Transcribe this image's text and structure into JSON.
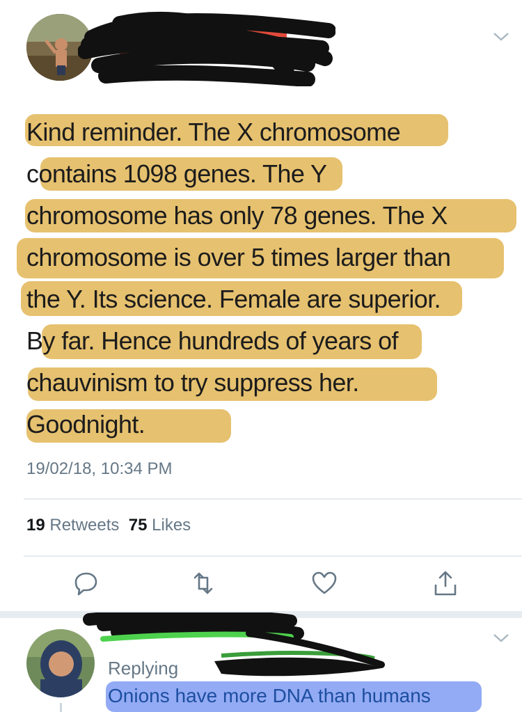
{
  "tweet": {
    "text_lines": [
      "Kind reminder. The X chromosome",
      "contains 1098 genes. The Y",
      "chromosome has only 78 genes. The X",
      "chromosome is over 5 times larger than",
      "the Y. Its science. Female are superior.",
      "By far. Hence hundreds of years of",
      "chauvinism to try suppress her.",
      "Goodnight."
    ],
    "timestamp": "19/02/18, 10:34 PM",
    "retweets_count": "19",
    "retweets_label": "Retweets",
    "likes_count": "75",
    "likes_label": "Likes"
  },
  "actions": {
    "reply_icon": "reply-icon",
    "retweet_icon": "retweet-icon",
    "like_icon": "heart-icon",
    "share_icon": "share-icon"
  },
  "reply": {
    "replying_label": "Replying",
    "text": "Onions have more DNA than humans"
  },
  "colors": {
    "highlight_yellow": "#e0b34f",
    "highlight_blue": "#6f8ff0",
    "muted_text": "#657786",
    "divider": "#e6ecf0"
  }
}
